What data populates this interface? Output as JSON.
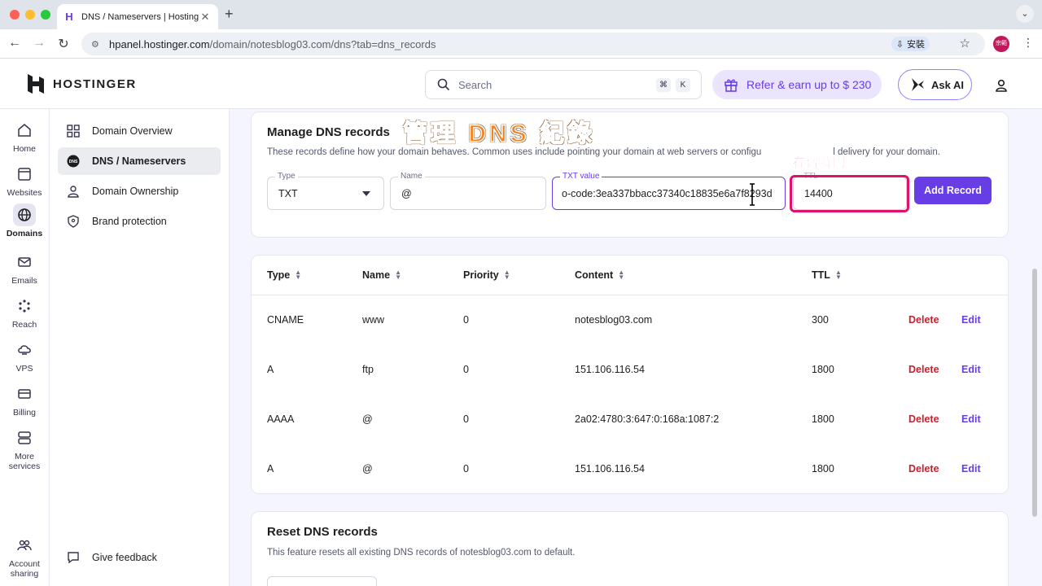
{
  "browser": {
    "tab_title": "DNS / Nameservers | Hostinger",
    "url_host": "hpanel.hostinger.com",
    "url_path": "/domain/notesblog03.com/dns?tab=dns_records",
    "install_label": "安裝",
    "profile_initials": "宗範"
  },
  "header": {
    "logo_text": "HOSTINGER",
    "search_placeholder": "Search",
    "search_key1": "⌘",
    "search_key2": "K",
    "refer_label": "Refer & earn up to $ 230",
    "ask_ai_label": "Ask AI"
  },
  "rail": {
    "items": [
      {
        "label": "Home"
      },
      {
        "label": "Websites"
      },
      {
        "label": "Domains"
      },
      {
        "label": "Emails"
      },
      {
        "label": "Reach"
      },
      {
        "label": "VPS"
      },
      {
        "label": "Billing"
      },
      {
        "label": "More services"
      },
      {
        "label": "Account sharing"
      }
    ]
  },
  "sidebar": {
    "items": [
      {
        "label": "Domain Overview"
      },
      {
        "label": "DNS / Nameservers"
      },
      {
        "label": "Domain Ownership"
      },
      {
        "label": "Brand protection"
      }
    ],
    "feedback_label": "Give feedback"
  },
  "manage": {
    "title": "Manage DNS records",
    "description": "These records define how your domain behaves. Common uses include pointing your domain at web servers or configu",
    "description_tail": "l delivery for your domain.",
    "type_label": "Type",
    "type_value": "TXT",
    "name_label": "Name",
    "name_value": "@",
    "txt_label": "TXT value",
    "txt_value": "o-code:3ea337bbacc37340c18835e6a7f8293d",
    "ttl_label": "TTL",
    "ttl_value": "14400",
    "add_button": "Add Record",
    "overlay_title": "管理 DNS 紀錄",
    "overlay_ttl": "存留時間"
  },
  "table": {
    "headers": [
      "Type",
      "Name",
      "Priority",
      "Content",
      "TTL"
    ],
    "delete_label": "Delete",
    "edit_label": "Edit",
    "rows": [
      {
        "type": "CNAME",
        "name": "www",
        "priority": "0",
        "content": "notesblog03.com",
        "ttl": "300"
      },
      {
        "type": "A",
        "name": "ftp",
        "priority": "0",
        "content": "151.106.116.54",
        "ttl": "1800"
      },
      {
        "type": "AAAA",
        "name": "@",
        "priority": "0",
        "content": "2a02:4780:3:647:0:168a:1087:2",
        "ttl": "1800"
      },
      {
        "type": "A",
        "name": "@",
        "priority": "0",
        "content": "151.106.116.54",
        "ttl": "1800"
      }
    ]
  },
  "reset": {
    "title": "Reset DNS records",
    "description": "This feature resets all existing DNS records of notesblog03.com to default."
  },
  "colors": {
    "accent": "#673de6",
    "danger": "#c6202e",
    "overlay_orange": "#f6821f",
    "overlay_pink": "#e6007e"
  }
}
